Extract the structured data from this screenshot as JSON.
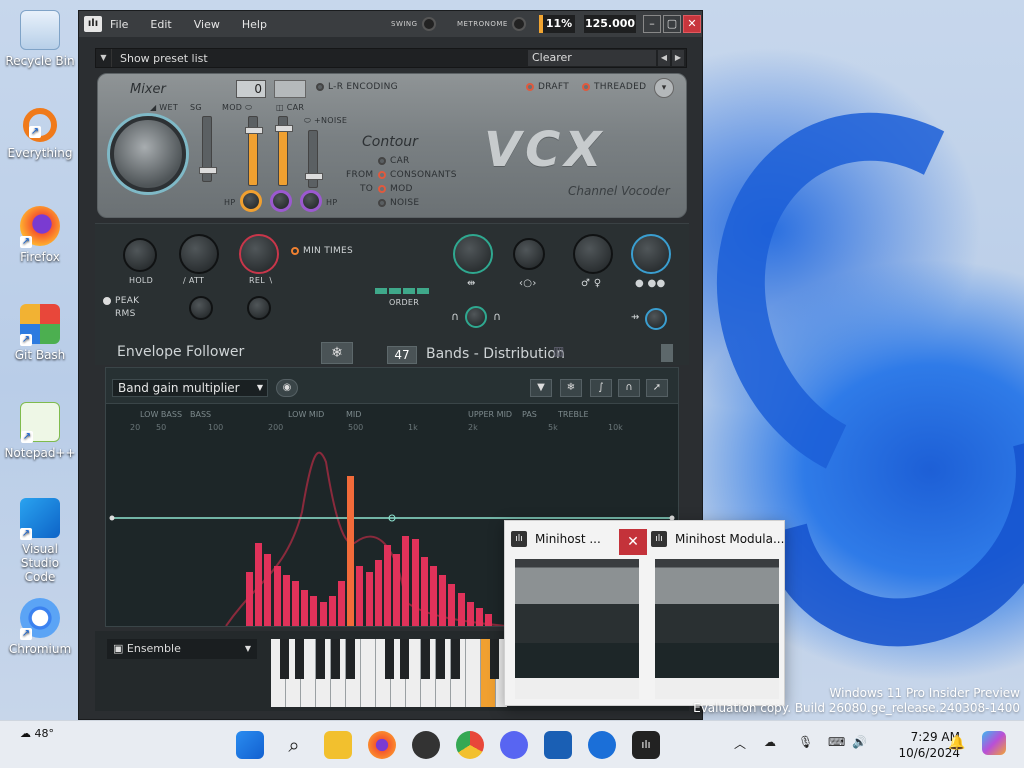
{
  "desktop": {
    "icons": [
      {
        "label": "Recycle Bin"
      },
      {
        "label": "Everything"
      },
      {
        "label": "Firefox"
      },
      {
        "label": "Git Bash"
      },
      {
        "label": "Notepad++"
      },
      {
        "label": "Visual Studio Code"
      },
      {
        "label": "Chromium"
      }
    ],
    "watermark_line1": "Windows 11 Pro Insider Preview",
    "watermark_line2": "Evaluation copy. Build 26080.ge_release.240308-1400"
  },
  "app": {
    "menu": [
      "File",
      "Edit",
      "View",
      "Help"
    ],
    "swing_label": "SWING",
    "metronome_label": "METRONOME",
    "cpu": "11%",
    "bpm": "125.000",
    "preset_bar": {
      "show_list_label": "Show preset list",
      "preset_name": "Clearer"
    },
    "vocoder": {
      "mixer_label": "Mixer",
      "wet": "WET",
      "sg": "SG",
      "mod": "MOD",
      "car": "CAR",
      "noise": "+NOISE",
      "mod_value": "0",
      "lr_encoding": "L-R ENCODING",
      "draft": "DRAFT",
      "threaded": "THREADED",
      "contour": "Contour",
      "from": "FROM",
      "to": "TO",
      "contour_opts": [
        "CAR",
        "CONSONANTS",
        "MOD",
        "NOISE"
      ],
      "logo": "VCX",
      "subtitle": "Channel Vocoder",
      "hp1": "HP",
      "hp2": "HP"
    },
    "envelope": {
      "hold": "HOLD",
      "att": "ATT",
      "rel": "REL",
      "min_times": "MIN TIMES",
      "peak": "PEAK",
      "rms": "RMS",
      "order": "ORDER",
      "title": "Envelope Follower",
      "bands_value": "47",
      "bands_label": "Bands - Distribution"
    },
    "graph": {
      "selector": "Band gain multiplier",
      "bands": [
        "LOW BASS",
        "BASS",
        "LOW MID",
        "MID",
        "UPPER MID",
        "PAS",
        "TREBLE"
      ],
      "freqs": [
        "20",
        "50",
        "100",
        "200",
        "500",
        "1k",
        "2k",
        "5k",
        "10k"
      ],
      "bars": [
        0.36,
        0.55,
        0.48,
        0.4,
        0.34,
        0.3,
        0.24,
        0.2,
        0.16,
        0.2,
        0.3,
        1.0,
        0.4,
        0.36,
        0.44,
        0.54,
        0.48,
        0.6,
        0.58,
        0.46,
        0.4,
        0.34,
        0.28,
        0.22,
        0.16,
        0.12,
        0.08
      ]
    },
    "bottom": {
      "ensemble": "Ensemble"
    }
  },
  "taskbar_popup": {
    "items": [
      {
        "title": "Minihost ..."
      },
      {
        "title": "Minihost Modula..."
      }
    ]
  },
  "taskbar": {
    "weather": "48°",
    "time": "7:29 AM",
    "date": "10/6/2024"
  }
}
